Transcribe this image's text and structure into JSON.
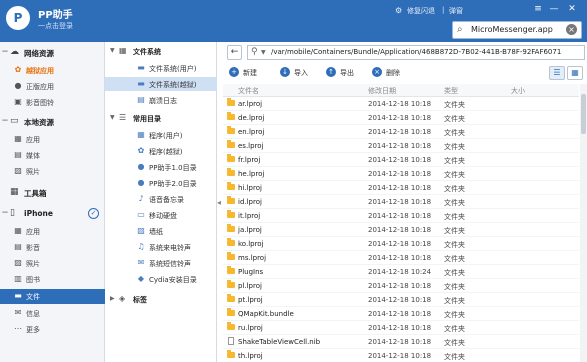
{
  "header": {
    "logo": "P",
    "title": "PP助手",
    "login": "一点击登录",
    "flash_link": "修复闪退",
    "popup_link": "弹窗",
    "divider": "|"
  },
  "search": {
    "value": "MicroMessenger.app",
    "clear": "×"
  },
  "sidebar": {
    "network": "网络资源",
    "jailbreak_apps": "越狱应用",
    "legit_apps": "正版应用",
    "video_pics": "影音图铃",
    "local": "本地资源",
    "local_apps": "应用",
    "local_media": "媒体",
    "local_photos": "照片",
    "toolbox": "工具箱",
    "device": "iPhone",
    "dev_apps": "应用",
    "dev_media": "影音",
    "dev_photos": "照片",
    "dev_books": "图书",
    "dev_files": "文件",
    "dev_info": "信息",
    "dev_more": "更多"
  },
  "tree": {
    "fs": "文件系统",
    "fs_user": "文件系统(用户)",
    "fs_jb": "文件系统(越狱)",
    "crash_log": "崩溃日志",
    "common": "常用目录",
    "prog_user": "程序(用户)",
    "prog_jb": "程序(越狱)",
    "pp1": "PP助手1.0目录",
    "pp2": "PP助手2.0目录",
    "voice_memo": "语音备忘录",
    "mobile_disk": "移动硬盘",
    "wallpaper": "墙纸",
    "ringtone": "系统来电铃声",
    "sms_tone": "系统短信铃声",
    "cydia": "Cydia安装目录",
    "tags": "标签"
  },
  "path": {
    "value": "/var/mobile/Containers/Bundle/Application/468B872D-7B02-441B-B78F-92FAF6071"
  },
  "toolbar": {
    "new": "新建",
    "import": "导入",
    "export": "导出",
    "delete": "删除"
  },
  "table": {
    "headers": {
      "name": "文件名",
      "date": "修改日期",
      "type": "类型",
      "size": "大小"
    },
    "rows": [
      {
        "name": "ar.lproj",
        "date": "2014-12-18 10:18",
        "type": "文件夹",
        "icon": "folder"
      },
      {
        "name": "de.lproj",
        "date": "2014-12-18 10:18",
        "type": "文件夹",
        "icon": "folder"
      },
      {
        "name": "en.lproj",
        "date": "2014-12-18 10:18",
        "type": "文件夹",
        "icon": "folder"
      },
      {
        "name": "es.lproj",
        "date": "2014-12-18 10:18",
        "type": "文件夹",
        "icon": "folder"
      },
      {
        "name": "fr.lproj",
        "date": "2014-12-18 10:18",
        "type": "文件夹",
        "icon": "folder"
      },
      {
        "name": "he.lproj",
        "date": "2014-12-18 10:18",
        "type": "文件夹",
        "icon": "folder"
      },
      {
        "name": "hi.lproj",
        "date": "2014-12-18 10:18",
        "type": "文件夹",
        "icon": "folder"
      },
      {
        "name": "id.lproj",
        "date": "2014-12-18 10:18",
        "type": "文件夹",
        "icon": "folder"
      },
      {
        "name": "it.lproj",
        "date": "2014-12-18 10:18",
        "type": "文件夹",
        "icon": "folder"
      },
      {
        "name": "ja.lproj",
        "date": "2014-12-18 10:18",
        "type": "文件夹",
        "icon": "folder"
      },
      {
        "name": "ko.lproj",
        "date": "2014-12-18 10:18",
        "type": "文件夹",
        "icon": "folder"
      },
      {
        "name": "ms.lproj",
        "date": "2014-12-18 10:18",
        "type": "文件夹",
        "icon": "folder"
      },
      {
        "name": "PlugIns",
        "date": "2014-12-18 10:24",
        "type": "文件夹",
        "icon": "folder"
      },
      {
        "name": "pl.lproj",
        "date": "2014-12-18 10:18",
        "type": "文件夹",
        "icon": "folder"
      },
      {
        "name": "pt.lproj",
        "date": "2014-12-18 10:18",
        "type": "文件夹",
        "icon": "folder"
      },
      {
        "name": "QMapKit.bundle",
        "date": "2014-12-18 10:18",
        "type": "文件夹",
        "icon": "folder"
      },
      {
        "name": "ru.lproj",
        "date": "2014-12-18 10:18",
        "type": "文件夹",
        "icon": "folder"
      },
      {
        "name": "ShakeTableViewCell.nib",
        "date": "2014-12-18 10:18",
        "type": "文件夹",
        "icon": "file"
      },
      {
        "name": "th.lproj",
        "date": "2014-12-18 10:18",
        "type": "文件夹",
        "icon": "folder"
      }
    ]
  },
  "colors": {
    "header": "#2e6db8",
    "active": "#2e6db8",
    "hot": "#e8730c",
    "folder": "#f5b82e"
  }
}
